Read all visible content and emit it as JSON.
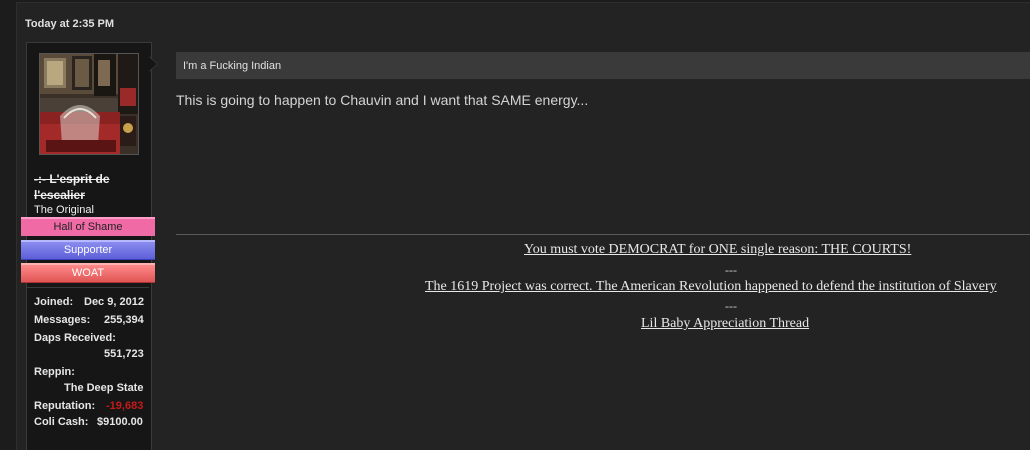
{
  "post": {
    "timestamp": "Today at 2:35 PM",
    "thread_title": "I'm a Fucking Indian",
    "message": "This is going to happen to Chauvin and I want that SAME energy..."
  },
  "user": {
    "username_line1": "-:- L'esprit de",
    "username_line2": "l'escalier",
    "user_title": "The Original",
    "banners": {
      "hall_of_shame": "Hall of Shame",
      "supporter": "Supporter",
      "woat": "WOAT"
    },
    "stats": {
      "joined_label": "Joined:",
      "joined_value": "Dec 9, 2012",
      "messages_label": "Messages:",
      "messages_value": "255,394",
      "daps_label": "Daps Received:",
      "daps_value": "551,723",
      "reppin_label": "Reppin:",
      "reppin_value": "The Deep State",
      "reputation_label": "Reputation:",
      "reputation_value": "-19,683",
      "coli_label": "Coli Cash:",
      "coli_value": "$9100.00"
    }
  },
  "signature": {
    "line1": "You must vote DEMOCRAT for ONE single reason: THE COURTS!",
    "dash1": "---",
    "line2": "The 1619 Project was correct. The American Revolution happened to defend the institution of Slavery",
    "dash2": "---",
    "line3": "Lil Baby Appreciation Thread"
  },
  "colors": {
    "background": "#1c1c1c",
    "post_bg": "#232323",
    "title_bar": "#3a3a3a",
    "hall_of_shame": "#f06aa6",
    "supporter": "#6b6de2",
    "woat": "#e86060",
    "negative_rep": "#c41a1a"
  }
}
